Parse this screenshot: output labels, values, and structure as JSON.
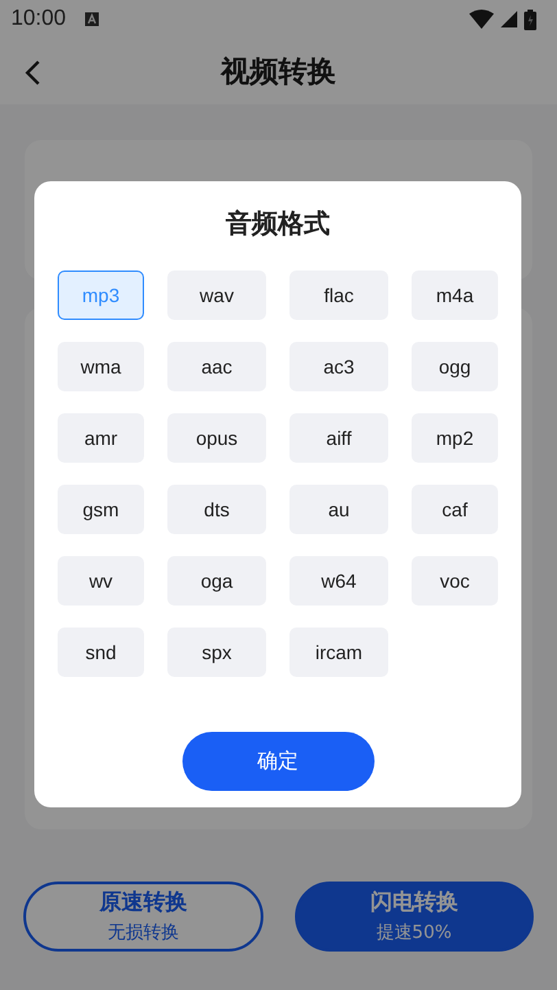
{
  "status_bar": {
    "time": "10:00"
  },
  "header": {
    "title": "视频转换"
  },
  "bottom_buttons": [
    {
      "title": "原速转换",
      "subtitle": "无损转换",
      "kind": "outline"
    },
    {
      "title": "闪电转换",
      "subtitle": "提速50%",
      "kind": "filled"
    }
  ],
  "dialog": {
    "title": "音频格式",
    "formats": [
      {
        "label": "mp3",
        "selected": true
      },
      {
        "label": "wav",
        "selected": false
      },
      {
        "label": "flac",
        "selected": false
      },
      {
        "label": "m4a",
        "selected": false
      },
      {
        "label": "wma",
        "selected": false
      },
      {
        "label": "aac",
        "selected": false
      },
      {
        "label": "ac3",
        "selected": false
      },
      {
        "label": "ogg",
        "selected": false
      },
      {
        "label": "amr",
        "selected": false
      },
      {
        "label": "opus",
        "selected": false
      },
      {
        "label": "aiff",
        "selected": false
      },
      {
        "label": "mp2",
        "selected": false
      },
      {
        "label": "gsm",
        "selected": false
      },
      {
        "label": "dts",
        "selected": false
      },
      {
        "label": "au",
        "selected": false
      },
      {
        "label": "caf",
        "selected": false
      },
      {
        "label": "wv",
        "selected": false
      },
      {
        "label": "oga",
        "selected": false
      },
      {
        "label": "w64",
        "selected": false
      },
      {
        "label": "voc",
        "selected": false
      },
      {
        "label": "snd",
        "selected": false
      },
      {
        "label": "spx",
        "selected": false
      },
      {
        "label": "ircam",
        "selected": false
      }
    ],
    "confirm": "确定"
  }
}
